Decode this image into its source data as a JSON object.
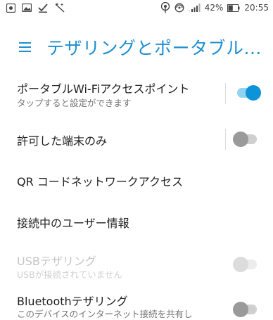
{
  "status_bar": {
    "battery_percent": "42%",
    "time": "20:55"
  },
  "app_bar": {
    "title": "テザリングとポータブル..."
  },
  "settings": [
    {
      "label": "ポータブルWi-Fiアクセスポイント",
      "subtitle": "タップすると設定ができます",
      "toggle": "on",
      "enabled": true
    },
    {
      "label": "許可した端末のみ",
      "toggle": "off",
      "enabled": true
    },
    {
      "label": "QR コードネットワークアクセス",
      "enabled": true
    },
    {
      "label": "接続中のユーザー情報",
      "enabled": true
    },
    {
      "label": "USBテザリング",
      "subtitle": "USBが接続されていません",
      "toggle": "off",
      "enabled": false
    },
    {
      "label": "Bluetoothテザリング",
      "subtitle": "このデバイスのインターネット接続を共有し",
      "toggle": "off",
      "enabled": true
    }
  ],
  "colors": {
    "accent": "#1e8fcf",
    "switch_on": "#0d93d8",
    "switch_off": "#9a9a9a"
  }
}
